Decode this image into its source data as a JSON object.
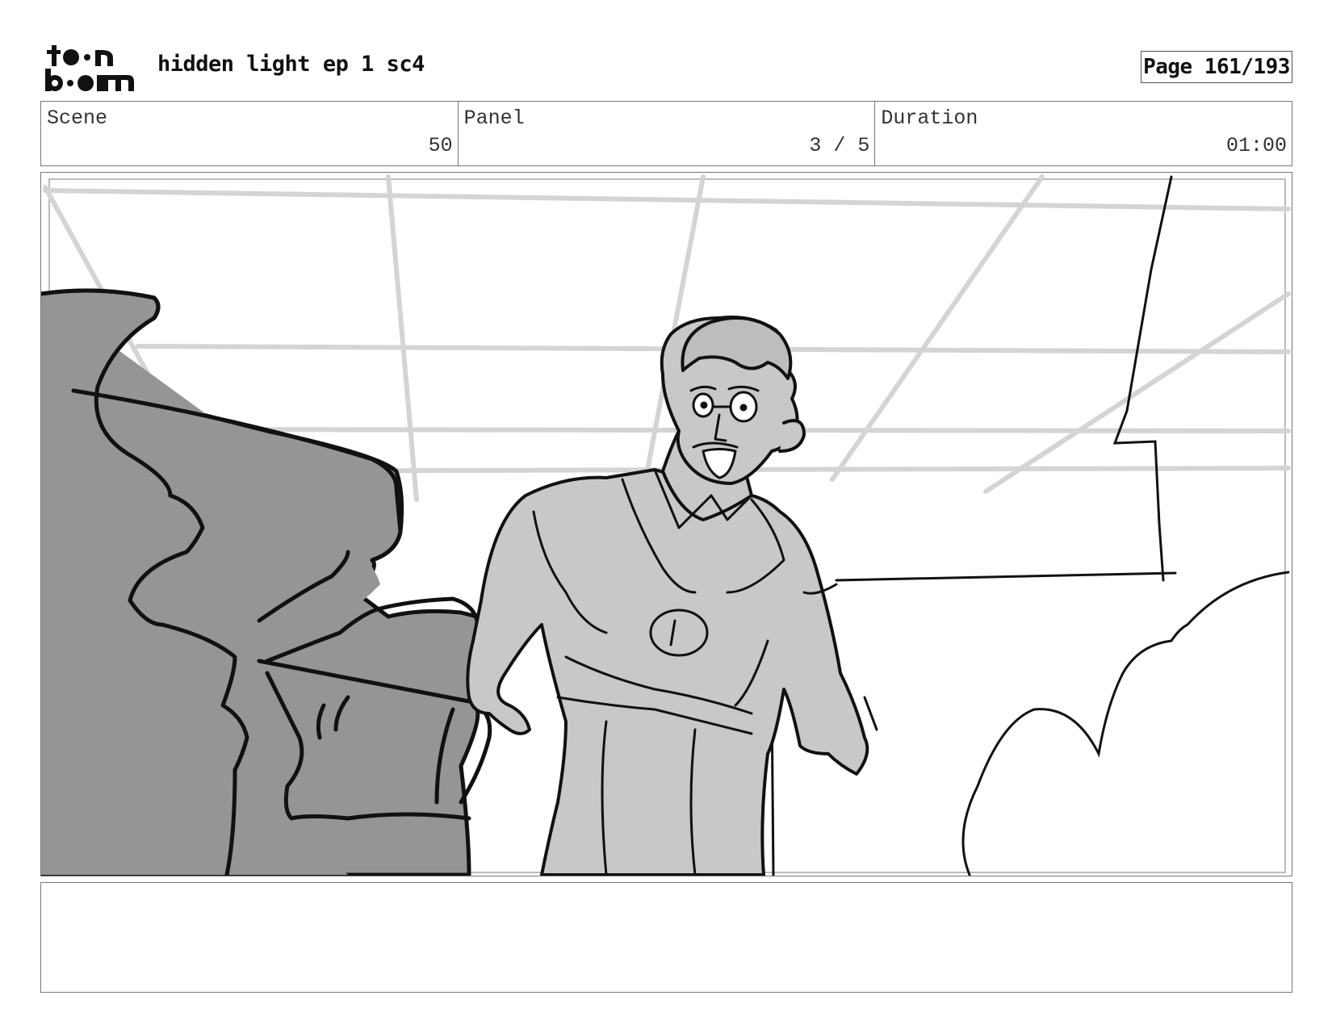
{
  "header": {
    "logo_text": "toon boom",
    "title": "hidden light ep 1 sc4",
    "page_label": "Page 161/193"
  },
  "info": {
    "scene_label": "Scene",
    "scene_value": "50",
    "panel_label": "Panel",
    "panel_value": "3 / 5",
    "duration_label": "Duration",
    "duration_value": "01:00"
  },
  "panel": {
    "image_semantic": "storyboard-sketch"
  },
  "notes": {
    "text": ""
  }
}
